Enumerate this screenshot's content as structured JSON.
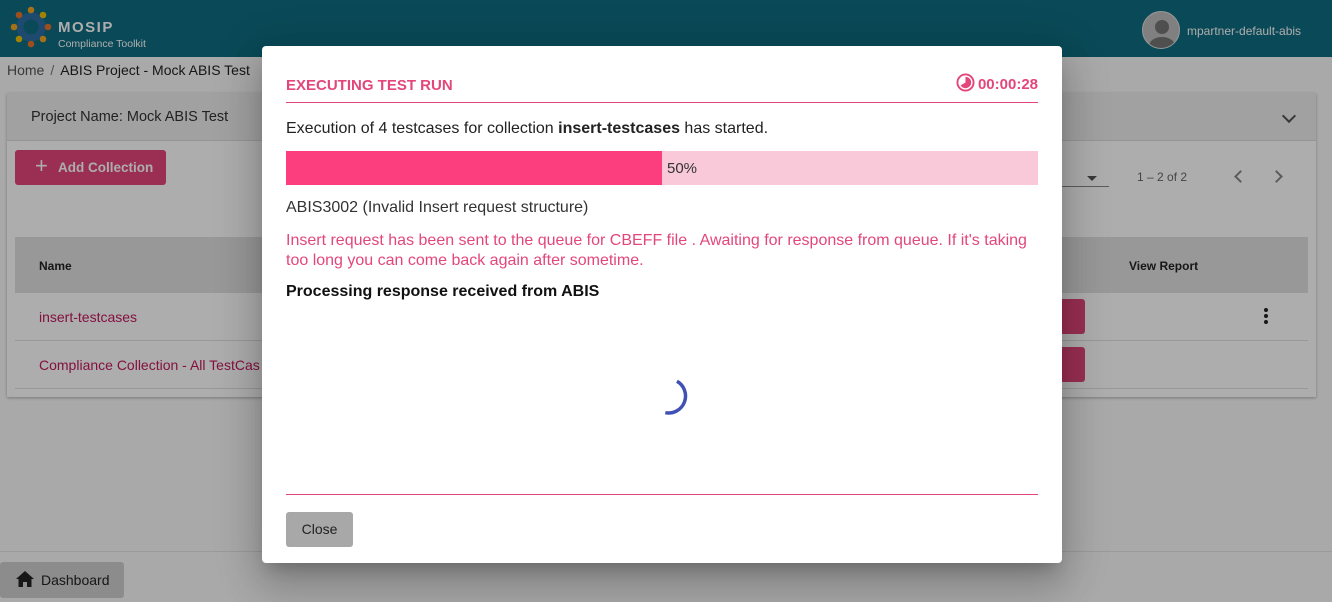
{
  "header": {
    "brand": "MOSIP",
    "brand_sub": "Compliance Toolkit",
    "username": "mpartner-default-abis"
  },
  "breadcrumb": {
    "home": "Home",
    "separator": "/",
    "current": "ABIS Project - Mock ABIS Test"
  },
  "project": {
    "title": "Project Name: Mock ABIS Test",
    "add_collection_label": "Add Collection",
    "paginator_range": "1 – 2 of 2",
    "columns": {
      "name": "Name",
      "view_report": "View Report"
    },
    "rows": [
      {
        "name": "insert-testcases"
      },
      {
        "name": "Compliance Collection - All TestCas"
      }
    ]
  },
  "footer": {
    "dashboard_label": "Dashboard"
  },
  "dialog": {
    "title": "EXECUTING TEST RUN",
    "timer": "00:00:28",
    "exec_prefix": "Execution of 4 testcases for collection ",
    "collection": "insert-testcases",
    "exec_suffix": " has started.",
    "progress_percent": 50,
    "progress_label": "50%",
    "testcase": "ABIS3002 (Invalid Insert request structure)",
    "status_message": "Insert request has been sent to the queue for CBEFF file . Awaiting for response from queue. If it's taking too long you can come back again after sometime.",
    "processing": "Processing response received from ABIS",
    "close_label": "Close"
  },
  "colors": {
    "topbar": "#0f6c80",
    "accent": "#e3467b",
    "progress_fill": "#fc3d7e",
    "progress_track": "#f9c9d9",
    "spinner": "#3f51b5"
  },
  "icons": [
    "mosip-logo-icon",
    "user-avatar-icon",
    "chevron-down-icon",
    "plus-icon",
    "dropdown-arrow-icon",
    "chevron-left-icon",
    "chevron-right-icon",
    "more-vert-icon",
    "home-icon",
    "timer-icon",
    "loading-spinner-icon"
  ]
}
